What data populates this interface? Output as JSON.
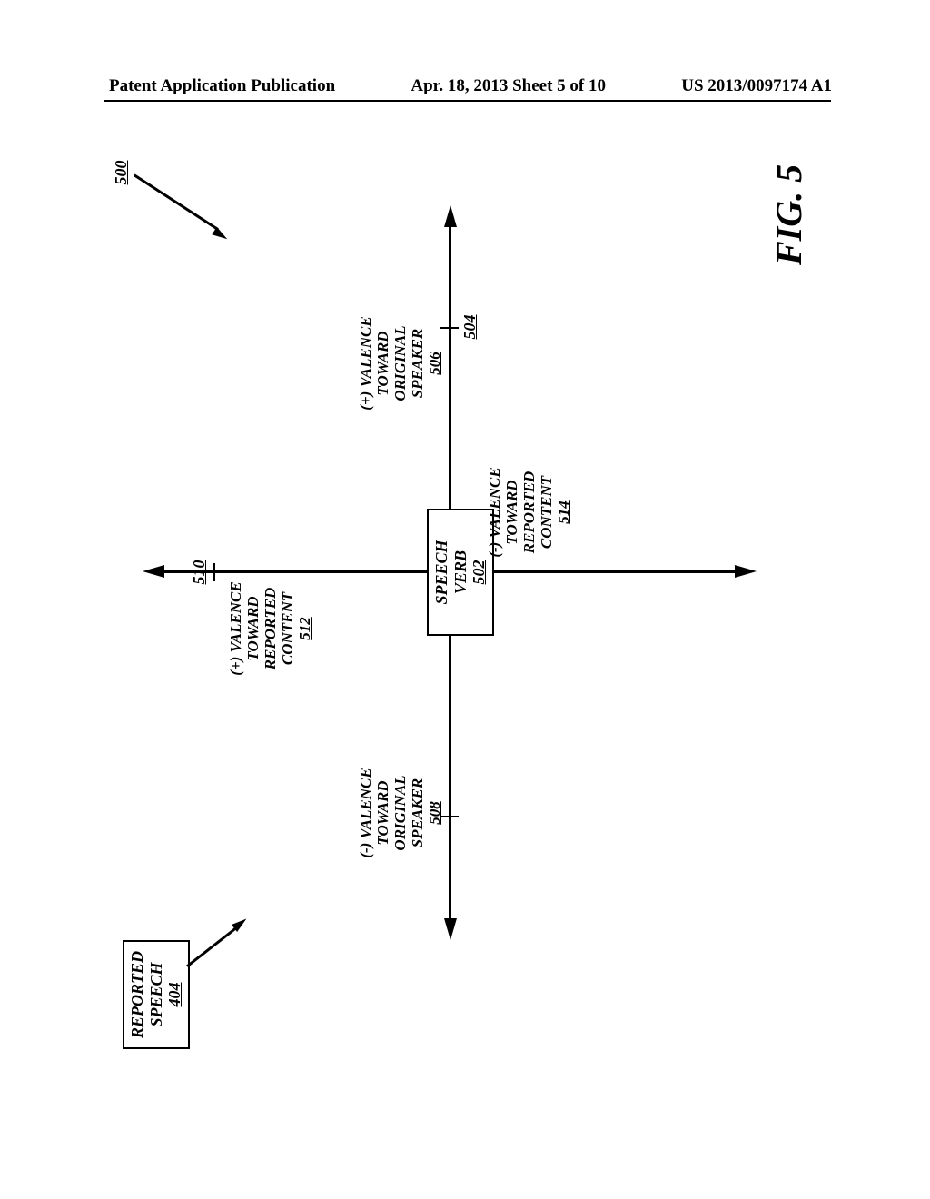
{
  "header": {
    "left": "Patent Application Publication",
    "center": "Apr. 18, 2013  Sheet 5 of 10",
    "right": "US 2013/0097174 A1"
  },
  "box_reported_speech": {
    "line1": "REPORTED",
    "line2": "SPEECH",
    "ref": "404"
  },
  "box_speech_verb": {
    "line1": "SPEECH VERB",
    "ref": "502"
  },
  "axis_right": {
    "l1": "(+) VALENCE",
    "l2": "TOWARD",
    "l3": "ORIGINAL",
    "l4": "SPEAKER",
    "ref": "506"
  },
  "axis_left": {
    "l1": "(-) VALENCE",
    "l2": "TOWARD",
    "l3": "ORIGINAL",
    "l4": "SPEAKER",
    "ref": "508"
  },
  "axis_up": {
    "l1": "(+) VALENCE",
    "l2": "TOWARD",
    "l3": "REPORTED",
    "l4": "CONTENT",
    "ref": "512"
  },
  "axis_down": {
    "l1": "(-) VALENCE",
    "l2": "TOWARD",
    "l3": "REPORTED",
    "l4": "CONTENT",
    "ref": "514"
  },
  "axis_h_ref": "504",
  "axis_v_ref": "510",
  "fig_ref": "500",
  "figure_label": "FIG. 5"
}
